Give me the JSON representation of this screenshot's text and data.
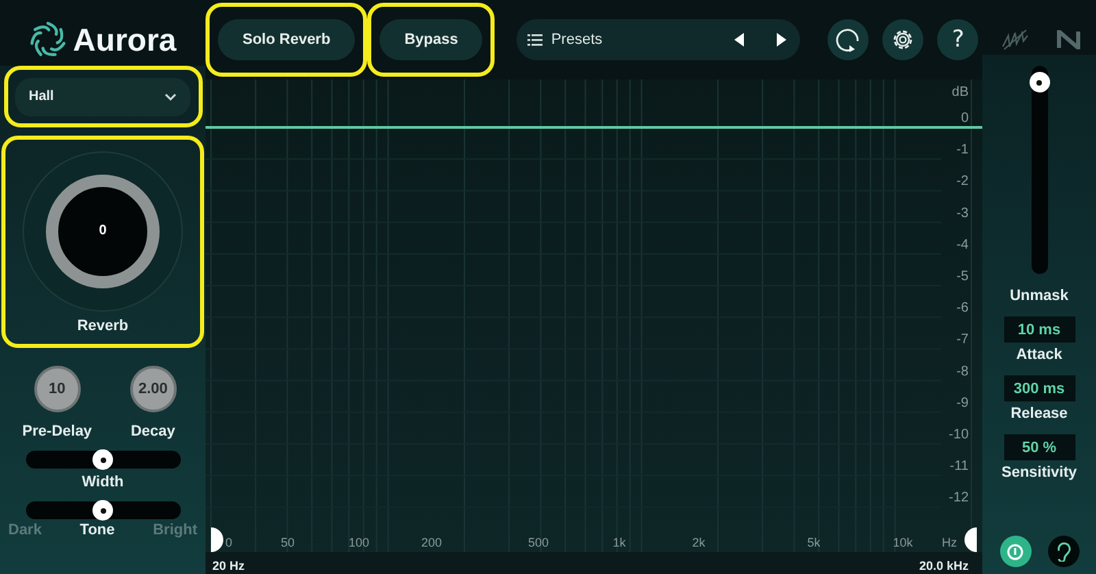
{
  "app": {
    "name": "Aurora"
  },
  "top_buttons": [
    {
      "label": "Solo Reverb",
      "highlighted": true
    },
    {
      "label": "Bypass",
      "highlighted": true
    }
  ],
  "presets": {
    "label": "Presets"
  },
  "help": {
    "label": "?"
  },
  "room": {
    "value": "Hall",
    "highlighted": true
  },
  "reverb": {
    "label": "Reverb",
    "value": "0",
    "highlighted": true
  },
  "knobs": [
    {
      "label": "Pre-Delay",
      "value": "10"
    },
    {
      "label": "Decay",
      "value": "2.00"
    }
  ],
  "width": {
    "label": "Width",
    "level": 0.5
  },
  "tone": {
    "label": "Tone",
    "left": "Dark",
    "right": "Bright",
    "level": 0.5
  },
  "unmask": {
    "label": "Unmask",
    "level": 1
  },
  "params": [
    {
      "value": "10 ms",
      "label": "Attack"
    },
    {
      "value": "300 ms",
      "label": "Release"
    },
    {
      "value": "50 %",
      "label": "Sensitivity"
    }
  ],
  "bottom_buttons": [
    {
      "kind": "power",
      "on": true
    },
    {
      "kind": "ear",
      "on": false
    }
  ],
  "graph": {
    "unit": "dB",
    "db_labels": [
      "0",
      "-1",
      "-2",
      "-3",
      "-4",
      "-5",
      "-6",
      "-7",
      "-8",
      "-9",
      "-10",
      "-11",
      "-12"
    ],
    "freq_labels": [
      "0",
      "50",
      "100",
      "200",
      "500",
      "1k",
      "2k",
      "5k",
      "10k",
      "Hz"
    ],
    "range_start": "20 Hz",
    "range_end": "20.0 kHz"
  }
}
